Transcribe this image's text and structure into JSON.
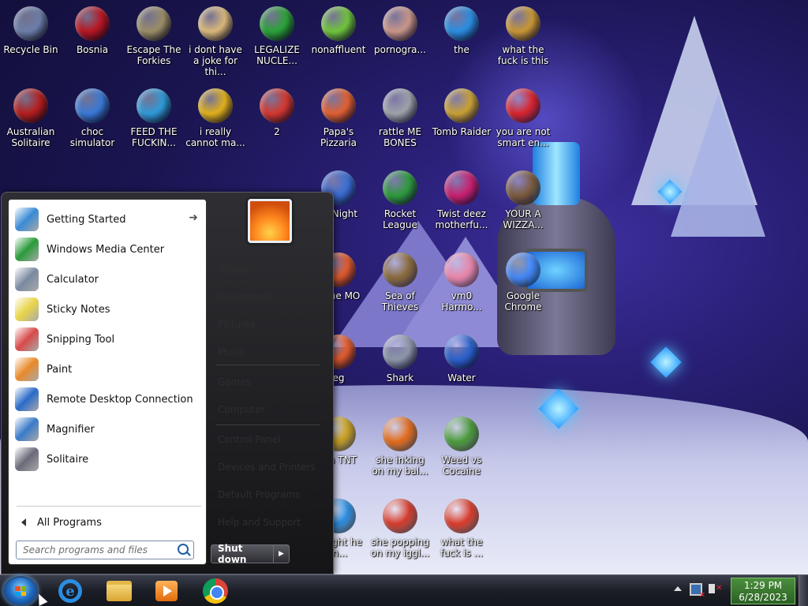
{
  "desktop": {
    "icons": [
      {
        "label": "Recycle Bin",
        "icon": "recycle-bin-icon",
        "color": "#6c7ea8"
      },
      {
        "label": "Bosnia",
        "icon": "bosnia-icon",
        "color": "#b81622"
      },
      {
        "label": "Escape The Forkies",
        "icon": "moon-icon",
        "color": "#9a8d66"
      },
      {
        "label": "i dont have a joke for thi...",
        "icon": "character-icon",
        "color": "#d9b87a"
      },
      {
        "label": "LEGALIZE NUCLE...",
        "icon": "radiation-icon",
        "color": "#2aa236"
      },
      {
        "label": "nonaffluent",
        "icon": "frog-icon",
        "color": "#6fc43b"
      },
      {
        "label": "pornogra...",
        "icon": "anime-icon",
        "color": "#c99688"
      },
      {
        "label": "the",
        "icon": "internet-explorer-icon",
        "color": "#2a8de0"
      },
      {
        "label": "what the fuck is this",
        "icon": "diamond-icon",
        "color": "#c89632"
      },
      {
        "label": "Australian Solitaire",
        "icon": "spider-icon",
        "color": "#b51d1d"
      },
      {
        "label": "choc simulator",
        "icon": "document-icon",
        "color": "#3a78d4"
      },
      {
        "label": "FEED THE FUCKIN...",
        "icon": "fish-icon",
        "color": "#2f9ad6"
      },
      {
        "label": "i really cannot ma...",
        "icon": "mahjong-icon",
        "color": "#e0b01a"
      },
      {
        "label": "2",
        "icon": "game-icon",
        "color": "#d4372e"
      },
      {
        "label": "Papa's Pizzaria",
        "icon": "pizza-icon",
        "color": "#e06030"
      },
      {
        "label": "rattle ME BONES",
        "icon": "skeleton-icon",
        "color": "#9ea2a8"
      },
      {
        "label": "Tomb Raider",
        "icon": "compass-icon",
        "color": "#c8a032"
      },
      {
        "label": "you are not smart en...",
        "icon": "dev-cpp-icon",
        "color": "#d8242c"
      },
      {
        "label": "at Night",
        "icon": "poptropica-icon",
        "color": "#3a6fd4"
      },
      {
        "label": "Rocket League",
        "icon": "rocket-league-icon",
        "color": "#2d9a3a"
      },
      {
        "label": "Twist deez motherfu...",
        "icon": "gem-icon",
        "color": "#c8206e"
      },
      {
        "label": "YOUR A WIZZA...",
        "icon": "wizard-icon",
        "color": "#7a5a3a"
      },
      {
        "label": "g the MO",
        "icon": "poptropica-icon",
        "color": "#e05a2a"
      },
      {
        "label": "Sea of Thieves",
        "icon": "skull-icon",
        "color": "#8a6a3a"
      },
      {
        "label": "vm0 Harmo...",
        "icon": "flower-icon",
        "color": "#e884a8"
      },
      {
        "label": "Google Chrome",
        "icon": "chrome-icon",
        "color": "#4285f4"
      },
      {
        "label": "eg",
        "icon": "poptropica-icon",
        "color": "#e05a2a"
      },
      {
        "label": "Shark",
        "icon": "shark-icon",
        "color": "#8c96a8"
      },
      {
        "label": "Water",
        "icon": "water-icon",
        "color": "#2a60c8"
      },
      {
        "label": "nia TNT",
        "icon": "smiley-icon",
        "color": "#c8a020"
      },
      {
        "label": "she inking on my bal...",
        "icon": "pen-icon",
        "color": "#e06a1a"
      },
      {
        "label": "Weed vs Cocaine",
        "icon": "plant-icon",
        "color": "#4a9a3a"
      },
      {
        "label": "r Night he In...",
        "icon": "internet-explorer-icon",
        "color": "#2a8de0"
      },
      {
        "label": "she popping on my iggl...",
        "icon": "creature-icon",
        "color": "#d43a2a"
      },
      {
        "label": "what the fuck is ...",
        "icon": "star-icon",
        "color": "#d83a2a"
      }
    ]
  },
  "start_menu": {
    "programs": [
      {
        "label": "Getting Started",
        "icon": "getting-started-icon",
        "color": "#3a8ad4"
      },
      {
        "label": "Windows Media Center",
        "icon": "media-center-icon",
        "color": "#2a9a3a"
      },
      {
        "label": "Calculator",
        "icon": "calculator-icon",
        "color": "#7a8aa0"
      },
      {
        "label": "Sticky Notes",
        "icon": "sticky-notes-icon",
        "color": "#e8d44a"
      },
      {
        "label": "Snipping Tool",
        "icon": "scissors-icon",
        "color": "#d84a4a"
      },
      {
        "label": "Paint",
        "icon": "paint-icon",
        "color": "#e88a2a"
      },
      {
        "label": "Remote Desktop Connection",
        "icon": "remote-desktop-icon",
        "color": "#2a6ac8"
      },
      {
        "label": "Magnifier",
        "icon": "magnifier-icon",
        "color": "#3a7ac8"
      },
      {
        "label": "Solitaire",
        "icon": "solitaire-icon",
        "color": "#6a6a7a"
      }
    ],
    "all_programs": "All Programs",
    "search_placeholder": "Search programs and files",
    "right_links": [
      "Nhang",
      "Documents",
      "Pictures",
      "Music",
      "Games",
      "Computer",
      "Control Panel",
      "Devices and Printers",
      "Default Programs",
      "Help and Support"
    ],
    "shutdown": "Shut down"
  },
  "taskbar": {
    "pinned": [
      "internet-explorer-icon",
      "windows-explorer-icon",
      "media-player-icon",
      "chrome-icon"
    ],
    "clock": {
      "time": "1:29 PM",
      "date": "6/28/2023"
    }
  }
}
